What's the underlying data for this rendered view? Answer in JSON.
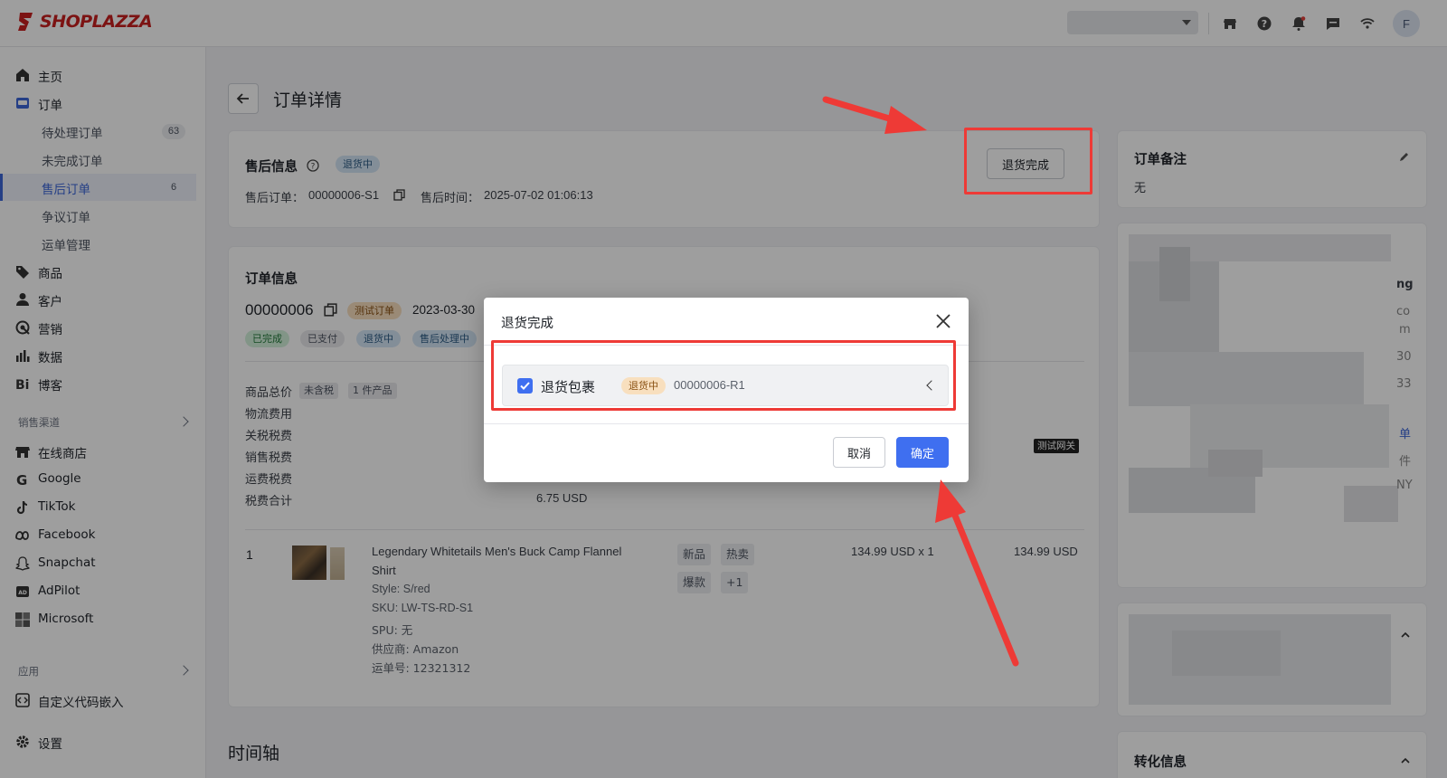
{
  "topbar": {
    "brand": "SHOPLAZZA",
    "avatar_letter": "F",
    "icons": [
      "store-icon",
      "help-icon",
      "bell-icon",
      "message-icon",
      "wifi-icon"
    ]
  },
  "sidebar": {
    "items": [
      {
        "label": "主页",
        "icon": "home-icon"
      },
      {
        "label": "订单",
        "icon": "order-icon"
      },
      {
        "label": "商品",
        "icon": "tag-icon"
      },
      {
        "label": "客户",
        "icon": "user-icon"
      },
      {
        "label": "营销",
        "icon": "marketing-icon"
      },
      {
        "label": "数据",
        "icon": "chart-icon"
      },
      {
        "label": "博客",
        "icon": "blog-icon"
      }
    ],
    "order_sub": [
      {
        "label": "待处理订单",
        "count": "63"
      },
      {
        "label": "未完成订单",
        "count": ""
      },
      {
        "label": "售后订单",
        "count": "6"
      },
      {
        "label": "争议订单",
        "count": ""
      },
      {
        "label": "运单管理",
        "count": ""
      }
    ],
    "channels_label": "销售渠道",
    "channels": [
      {
        "label": "在线商店",
        "icon": "store-icon"
      },
      {
        "label": "Google",
        "icon": "google-icon"
      },
      {
        "label": "TikTok",
        "icon": "tiktok-icon"
      },
      {
        "label": "Facebook",
        "icon": "meta-icon"
      },
      {
        "label": "Snapchat",
        "icon": "snapchat-icon"
      },
      {
        "label": "AdPilot",
        "icon": "adpilot-icon"
      },
      {
        "label": "Microsoft",
        "icon": "microsoft-icon"
      }
    ],
    "apps_label": "应用",
    "apps": [
      {
        "label": "自定义代码嵌入",
        "icon": "code-embed-icon"
      }
    ],
    "settings_label": "设置"
  },
  "page": {
    "title": "订单详情",
    "after_sale": {
      "title": "售后信息",
      "status_tag": "退货中",
      "order_label": "售后订单：",
      "order_no": "00000006-S1",
      "time_label": "售后时间：",
      "time": "2025-07-02 01:06:13",
      "action_button": "退货完成"
    },
    "order_info": {
      "title": "订单信息",
      "order_no": "00000006",
      "test_tag": "测试订单",
      "date": "2023-03-30",
      "status_tags": [
        "已完成",
        "已支付",
        "退货中",
        "售后处理中"
      ],
      "summary_rows": [
        {
          "label": "商品总价",
          "tags": [
            "未含税",
            "1 件产品"
          ],
          "value": ""
        },
        {
          "label": "物流费用",
          "value": ""
        },
        {
          "label": "关税税费",
          "value": ""
        },
        {
          "label": "销售税费",
          "value": ""
        },
        {
          "label": "运费税费",
          "value": ""
        },
        {
          "label": "税费合计",
          "value": "6.75 USD"
        }
      ],
      "gateway_tag": "测试网关",
      "product": {
        "index": "1",
        "name_line1": "Legendary Whitetails Men's Buck Camp Flannel",
        "name_line2": "Shirt",
        "style": "Style: S/red",
        "sku": "SKU: LW-TS-RD-S1",
        "spu": "SPU: 无",
        "supplier": "供应商: Amazon",
        "tracking": "运单号: 12321312",
        "tags": [
          "新品",
          "热卖",
          "爆款",
          "+1"
        ],
        "unit_price": "134.99 USD x 1",
        "total": "134.99 USD"
      }
    },
    "timeline_title": "时间轴",
    "notes": {
      "title": "订单备注",
      "value": "无"
    },
    "right_partial": {
      "texts": [
        "ng",
        "co",
        "m",
        "30",
        "33",
        "单",
        "件",
        "NY"
      ]
    },
    "conversion_title": "转化信息"
  },
  "modal": {
    "title": "退货完成",
    "package_label": "退货包裹",
    "package_tag": "退货中",
    "package_id": "00000006-R1",
    "cancel": "取消",
    "confirm": "确定"
  },
  "colors": {
    "brand_red": "#c8201f",
    "primary_blue": "#3f6ff0",
    "annotation_red": "#ee3a36"
  }
}
